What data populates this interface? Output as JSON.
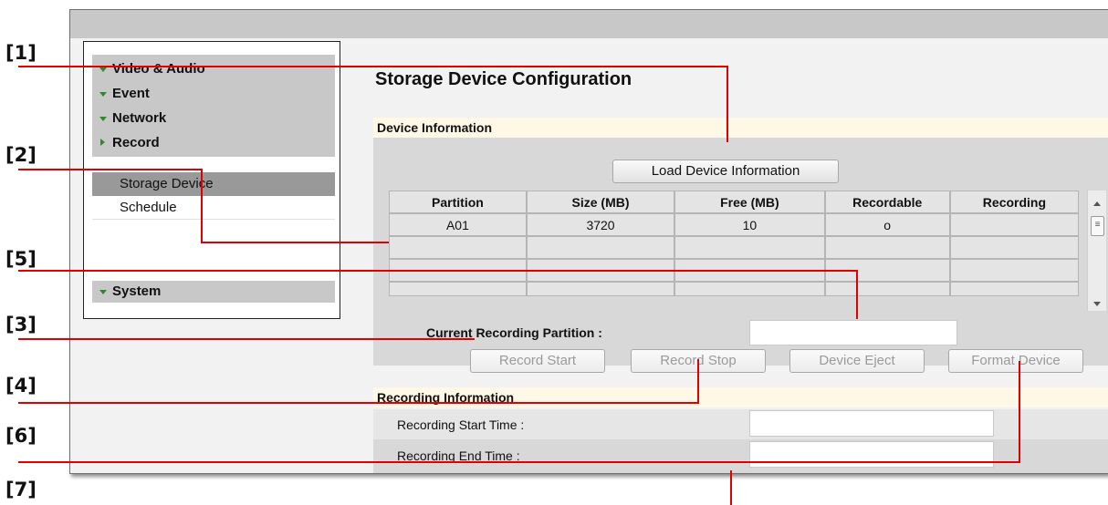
{
  "callouts": [
    "[1]",
    "[2]",
    "[5]",
    "[3]",
    "[4]",
    "[6]",
    "[7]"
  ],
  "sidebar": {
    "groups": [
      {
        "label": "Video & Audio",
        "icon": "triangle-down"
      },
      {
        "label": "Event",
        "icon": "triangle-down"
      },
      {
        "label": "Network",
        "icon": "triangle-down"
      },
      {
        "label": "Record",
        "icon": "triangle-right"
      }
    ],
    "subitems": [
      {
        "label": "Storage Device",
        "selected": true
      },
      {
        "label": "Schedule",
        "selected": false
      }
    ],
    "system": {
      "label": "System",
      "icon": "triangle-down"
    }
  },
  "page_title": "Storage Device Configuration",
  "device_info": {
    "section_title": "Device Information",
    "load_button": "Load Device Information",
    "columns": [
      "Partition",
      "Size (MB)",
      "Free (MB)",
      "Recordable",
      "Recording"
    ],
    "rows": [
      [
        "A01",
        "3720",
        "10",
        "o",
        ""
      ],
      [
        "",
        "",
        "",
        "",
        ""
      ],
      [
        "",
        "",
        "",
        "",
        ""
      ],
      [
        "",
        "",
        "",
        "",
        ""
      ]
    ],
    "current_partition_label": "Current Recording Partition :",
    "current_partition_value": "",
    "buttons": {
      "record_start": "Record Start",
      "record_stop": "Record Stop",
      "device_eject": "Device Eject",
      "format_device": "Format Device"
    }
  },
  "recording_info": {
    "section_title": "Recording Information",
    "start_label": "Recording Start Time :",
    "end_label": "Recording End Time :",
    "start_value": "",
    "end_value": ""
  },
  "colors": {
    "callout_line": "#e00000",
    "section_header": "#fff8e6",
    "menu_bg": "#c8c8c8",
    "selected_bg": "#999999",
    "arrow": "#2d8a2d"
  }
}
